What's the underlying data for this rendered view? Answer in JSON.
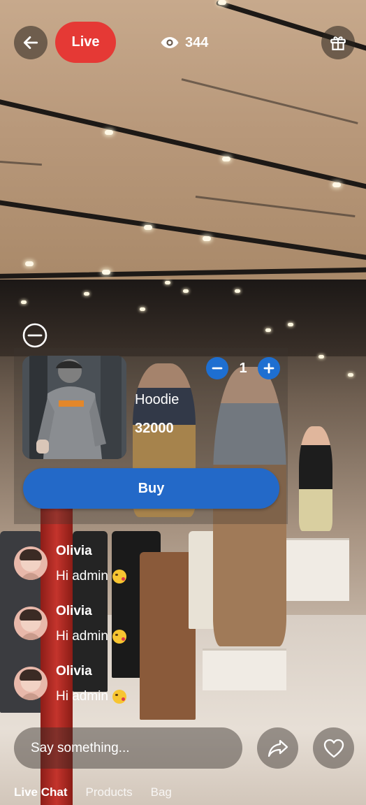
{
  "header": {
    "live_label": "Live",
    "viewer_count": "344",
    "icons": {
      "back": "back-arrow-icon",
      "viewers": "eye-icon",
      "gift": "gift-icon"
    }
  },
  "product": {
    "name": "Hoodie",
    "price": "32000",
    "quantity": "1",
    "buy_label": "Buy",
    "icons": {
      "collapse": "minus-circle-icon",
      "decrease": "minus-icon",
      "increase": "plus-icon"
    }
  },
  "chat": {
    "messages": [
      {
        "user": "Olivia",
        "text": "Hi admin"
      },
      {
        "user": "Olivia",
        "text": "Hi admin"
      },
      {
        "user": "Olivia",
        "text": "Hi admin"
      }
    ]
  },
  "composer": {
    "placeholder": "Say something...",
    "icons": {
      "share": "share-icon",
      "like": "heart-icon"
    }
  },
  "tabs": [
    {
      "label": "Live Chat",
      "active": true
    },
    {
      "label": "Products",
      "active": false
    },
    {
      "label": "Bag",
      "active": false
    }
  ],
  "colors": {
    "live_badge": "#e53935",
    "primary_button": "#2369c8",
    "stepper_button": "#1e6fd1"
  }
}
